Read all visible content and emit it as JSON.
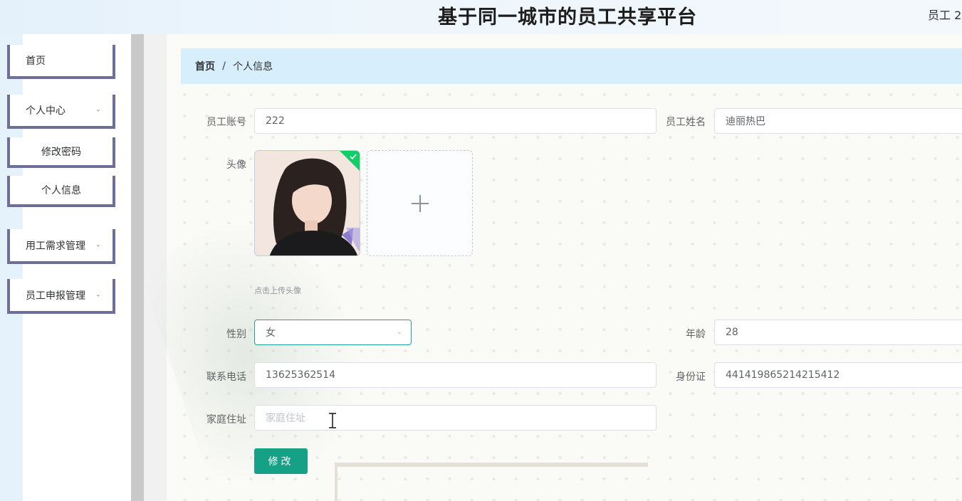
{
  "header": {
    "title": "基于同一城市的员工共享平台",
    "user": "员工 2"
  },
  "sidebar": {
    "items": [
      {
        "label": "首页"
      },
      {
        "label": "个人中心"
      },
      {
        "label": "修改密码"
      },
      {
        "label": "个人信息"
      },
      {
        "label": "用工需求管理"
      },
      {
        "label": "员工申报管理"
      }
    ]
  },
  "breadcrumb": {
    "home": "首页",
    "separator": "/",
    "current": "个人信息"
  },
  "form": {
    "account": {
      "label": "员工账号",
      "value": "222"
    },
    "name": {
      "label": "员工姓名",
      "value": "迪丽热巴"
    },
    "avatar": {
      "label": "头像",
      "hint": "点击上传头像"
    },
    "gender": {
      "label": "性别",
      "value": "女"
    },
    "age": {
      "label": "年龄",
      "value": "28"
    },
    "phone": {
      "label": "联系电话",
      "value": "13625362514"
    },
    "id_card": {
      "label": "身份证",
      "value": "441419865214215412"
    },
    "address": {
      "label": "家庭住址",
      "value": "",
      "placeholder": "家庭住址"
    },
    "submit_label": "修改"
  },
  "colors": {
    "accent": "#16a085",
    "breadcrumb_bg": "#d7eefc",
    "menu_border": "#6e6f96"
  }
}
